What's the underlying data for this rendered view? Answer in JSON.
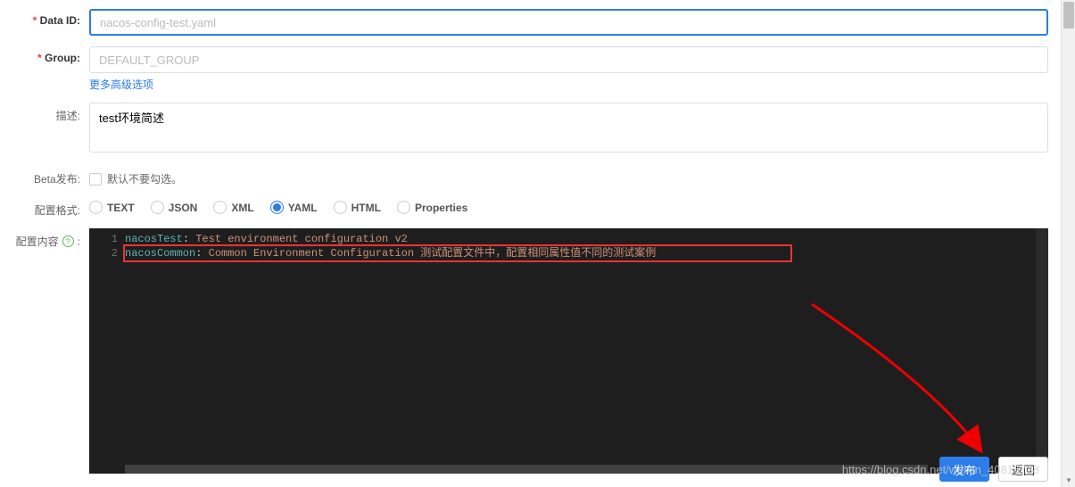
{
  "form": {
    "dataId": {
      "label": "Data ID:",
      "placeholder": "nacos-config-test.yaml"
    },
    "group": {
      "label": "Group:",
      "placeholder": "DEFAULT_GROUP"
    },
    "advancedLink": "更多高级选项",
    "description": {
      "label": "描述:",
      "value": "test环境简述"
    },
    "beta": {
      "label": "Beta发布:",
      "checkboxLabel": "默认不要勾选。"
    },
    "format": {
      "label": "配置格式:",
      "options": [
        "TEXT",
        "JSON",
        "XML",
        "YAML",
        "HTML",
        "Properties"
      ],
      "selected": "YAML"
    },
    "content": {
      "label": "配置内容"
    }
  },
  "editor": {
    "lines": [
      {
        "num": "1",
        "key": "nacosTest",
        "value": "Test environment configuration v2"
      },
      {
        "num": "2",
        "key": "nacosCommon",
        "value": "Common Environment Configuration 测试配置文件中，配置相同属性值不同的测试案例"
      }
    ]
  },
  "footer": {
    "publish": "发布",
    "back": "返回"
  },
  "watermark": "https://blog.csdn.net/weixin_40816738"
}
